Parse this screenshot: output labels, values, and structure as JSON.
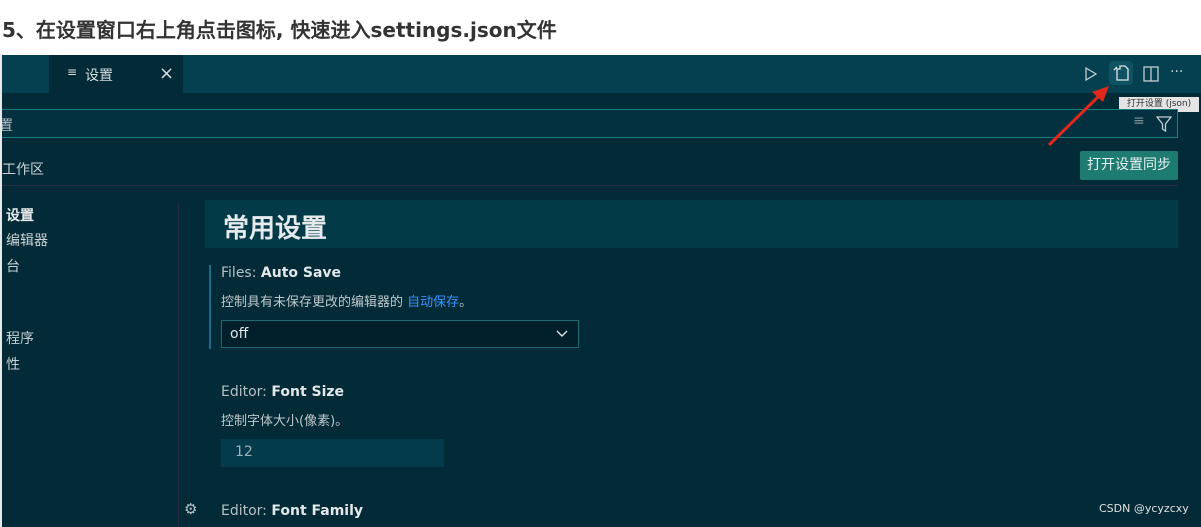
{
  "heading": "5、在设置窗口右上角点击图标, 快速进入settings.json文件",
  "tab": {
    "label": "设置",
    "icon": "preview-lines-icon",
    "close": "×"
  },
  "toolbar": {
    "run": "run-icon",
    "open_json": "open-settings-json-icon",
    "split": "split-editor-icon",
    "more": "···",
    "tooltip": "打开设置 (json)"
  },
  "search": {
    "placeholder_fragment": "置"
  },
  "scope_tab": "工作区",
  "sync_button": "打开设置同步",
  "nav": [
    "设置",
    "编辑器",
    "台",
    "",
    "程序",
    "性"
  ],
  "section_title": "常用设置",
  "settings": [
    {
      "category": "Files: ",
      "name": "Auto Save",
      "desc": "控制具有未保存更改的编辑器的 ",
      "link": "自动保存",
      "desc_end": "。",
      "value": "off"
    },
    {
      "category": "Editor: ",
      "name": "Font Size",
      "desc": "控制字体大小(像素)。",
      "value": "12"
    },
    {
      "category": "Editor: ",
      "name": "Font Family"
    }
  ],
  "watermark": "CSDN @ycyzcxy",
  "colors": {
    "accent": "#1d7b72",
    "link": "#3794ff",
    "arrow": "#e0281c"
  }
}
